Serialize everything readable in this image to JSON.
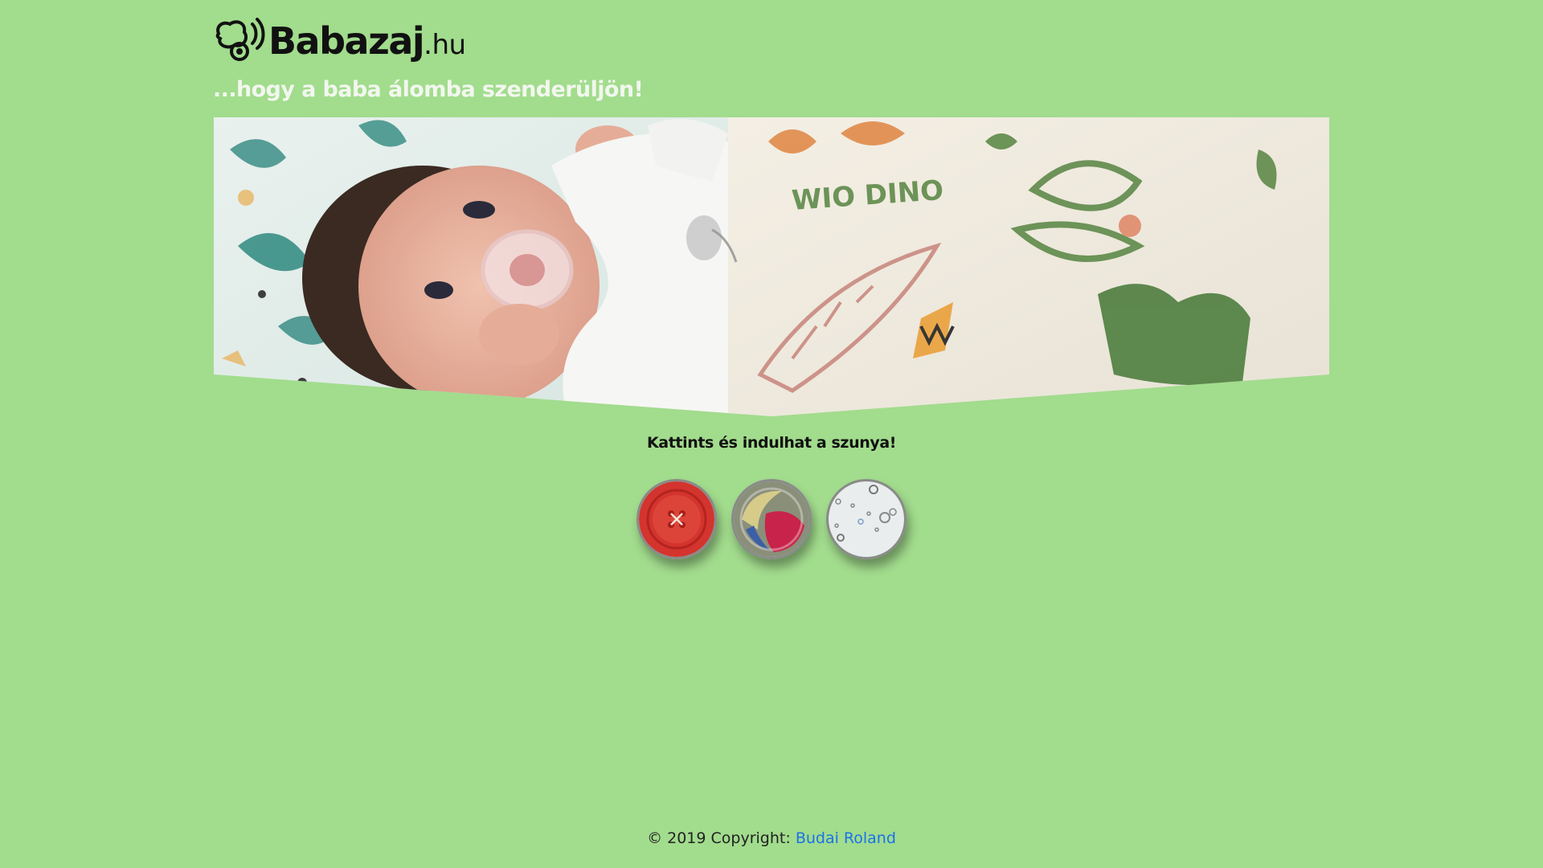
{
  "header": {
    "logo_main": "Babazaj",
    "logo_tld": ".hu",
    "tagline": "...hogy a baba álomba szenderüljön!"
  },
  "hero": {
    "image_subject": "baby-with-pacifier-under-blanket",
    "blanket_text": "WIO DINO"
  },
  "main": {
    "cta_text": "Kattints és indulhat a szunya!",
    "sound_buttons": [
      {
        "icon": "red-button-icon",
        "color": "#d3342e"
      },
      {
        "icon": "washing-machine-icon",
        "color": "#c8234a"
      },
      {
        "icon": "water-bubbles-icon",
        "color": "#e9edee"
      }
    ]
  },
  "footer": {
    "copyright": "© 2019 Copyright:",
    "author": "Budai Roland"
  },
  "colors": {
    "background": "#a2dc8d",
    "link": "#1a73e8"
  }
}
